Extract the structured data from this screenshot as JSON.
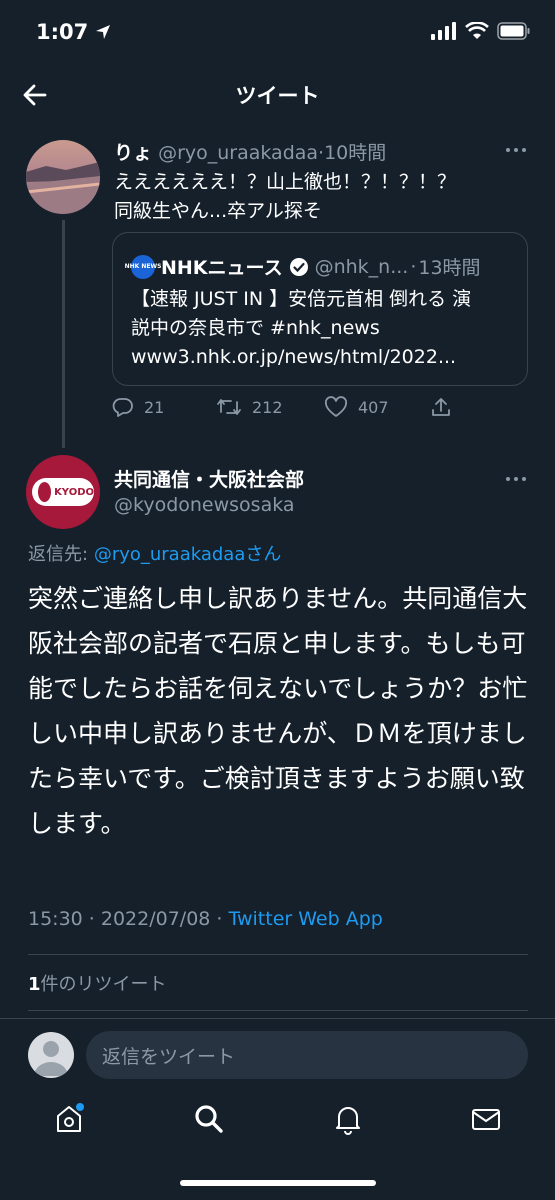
{
  "status_bar": {
    "time": "1:07"
  },
  "header": {
    "title": "ツイート"
  },
  "reply_parent": {
    "name": "りょ",
    "handle": "@ryo_uraakadaa",
    "time": "10時間",
    "text_line1": "ええええええ！？山上徹也！？！？！？",
    "text_line2": "同級生やん...卒アル探そ",
    "quote": {
      "name": "NHKニュース",
      "handle": "@nhk_n...",
      "time": "13時間",
      "logo_text": "NHK NEWS",
      "line1": "【速報 JUST IN 】安倍元首相 倒れる 演",
      "line2": "説中の奈良市で #nhk_news",
      "line3": "www3.nhk.or.jp/news/html/2022..."
    },
    "actions": {
      "replies": "21",
      "retweets": "212",
      "likes": "407"
    }
  },
  "main_tweet": {
    "name": "共同通信・大阪社会部",
    "handle": "@kyodonewsosaka",
    "avatar_text": "KYODO",
    "reply_label": "返信先:",
    "reply_handle": "@ryo_uraakadaa",
    "reply_suffix": "さん",
    "body": "突然ご連絡し申し訳ありません。共同通信大阪社会部の記者で石原と申します。もしも可能でしたらお話を伺えないでしょうか？お忙しい中申し訳ありませんが、ＤＭを頂けましたら幸いです。ご検討頂きますようお願い致します。",
    "timestamp": "15:30 · 2022/07/08 · ",
    "source": "Twitter Web App",
    "retweet_count": "1",
    "retweet_label": "件のリツイート"
  },
  "reply_bar": {
    "placeholder": "返信をツイート"
  },
  "colors": {
    "background": "#15202b",
    "accent": "#1d9bf0",
    "muted": "#8b98a5"
  },
  "tabs": [
    "home-icon",
    "search-icon",
    "notifications-icon",
    "messages-icon"
  ]
}
